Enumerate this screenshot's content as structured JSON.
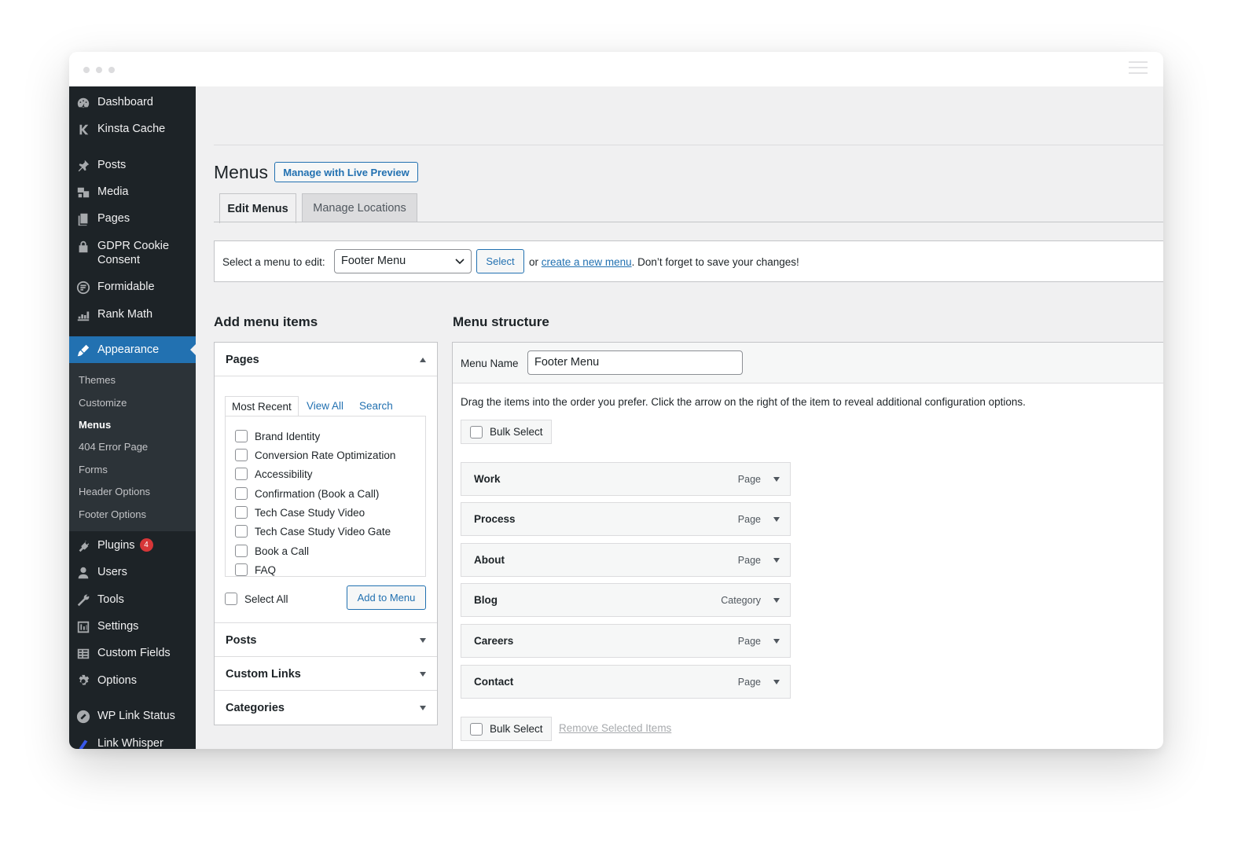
{
  "sidebar": {
    "items": [
      {
        "label": "Dashboard",
        "icon": "dashboard-icon"
      },
      {
        "label": "Kinsta Cache",
        "icon": "kinsta-icon"
      },
      {
        "label": "Posts",
        "icon": "pin-icon"
      },
      {
        "label": "Media",
        "icon": "media-icon"
      },
      {
        "label": "Pages",
        "icon": "pages-icon"
      },
      {
        "label": "GDPR Cookie Consent",
        "icon": "lock-icon"
      },
      {
        "label": "Formidable",
        "icon": "formidable-icon"
      },
      {
        "label": "Rank Math",
        "icon": "chart-icon"
      },
      {
        "label": "Appearance",
        "icon": "brush-icon"
      },
      {
        "label": "Plugins",
        "icon": "plug-icon",
        "badge": "4"
      },
      {
        "label": "Users",
        "icon": "user-icon"
      },
      {
        "label": "Tools",
        "icon": "wrench-icon"
      },
      {
        "label": "Settings",
        "icon": "settings-icon"
      },
      {
        "label": "Custom Fields",
        "icon": "table-icon"
      },
      {
        "label": "Options",
        "icon": "gear-icon"
      },
      {
        "label": "WP Link Status",
        "icon": "link-icon"
      },
      {
        "label": "Link Whisper",
        "icon": "whisper-icon"
      }
    ],
    "submenu": [
      "Themes",
      "Customize",
      "Menus",
      "404 Error Page",
      "Forms",
      "Header Options",
      "Footer Options"
    ]
  },
  "page": {
    "title": "Menus",
    "live_preview": "Manage with Live Preview",
    "tabs": [
      "Edit Menus",
      "Manage Locations"
    ]
  },
  "select_bar": {
    "label": "Select a menu to edit:",
    "selected": "Footer Menu",
    "button": "Select",
    "help_prefix": "or",
    "help_link": "create a new menu",
    "help_suffix": ". Don’t forget to save your changes!"
  },
  "add_items": {
    "heading": "Add menu items",
    "pages_title": "Pages",
    "inner_tabs": [
      "Most Recent",
      "View All",
      "Search"
    ],
    "pages": [
      "Brand Identity",
      "Conversion Rate Optimization",
      "Accessibility",
      "Confirmation (Book a Call)",
      "Tech Case Study Video",
      "Tech Case Study Video Gate",
      "Book a Call",
      "FAQ"
    ],
    "select_all": "Select All",
    "add_button": "Add to Menu",
    "sections": [
      "Posts",
      "Custom Links",
      "Categories"
    ]
  },
  "structure": {
    "heading": "Menu structure",
    "name_label": "Menu Name",
    "name_value": "Footer Menu",
    "instructions": "Drag the items into the order you prefer. Click the arrow on the right of the item to reveal additional configuration options.",
    "bulk_select": "Bulk Select",
    "items": [
      {
        "title": "Work",
        "type": "Page"
      },
      {
        "title": "Process",
        "type": "Page"
      },
      {
        "title": "About",
        "type": "Page"
      },
      {
        "title": "Blog",
        "type": "Category"
      },
      {
        "title": "Careers",
        "type": "Page"
      },
      {
        "title": "Contact",
        "type": "Page"
      }
    ],
    "remove": "Remove Selected Items"
  },
  "colors": {
    "sidebar": "#1d2327",
    "accent": "#2271b1",
    "badge": "#d63638"
  }
}
